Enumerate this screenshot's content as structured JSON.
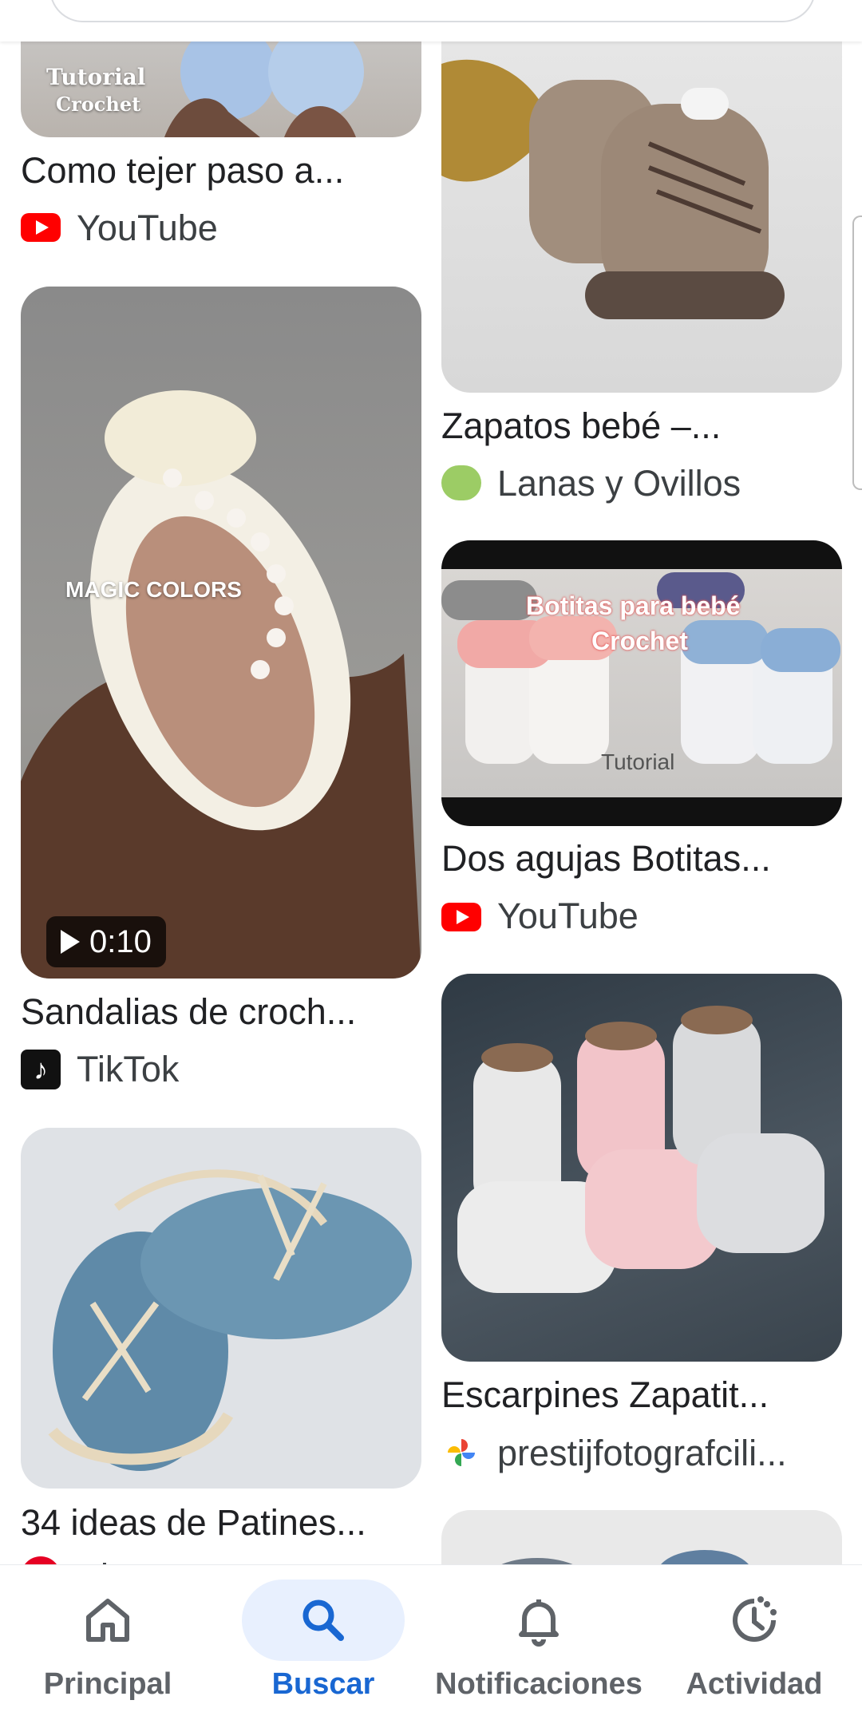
{
  "results_left": [
    {
      "title": "Como tejer paso a...",
      "source": "YouTube",
      "source_icon": "youtube-icon",
      "thumb_text": [
        "Tutorial",
        "Crochet"
      ]
    },
    {
      "title": "Sandalias de croch...",
      "source": "TikTok",
      "source_icon": "tiktok-icon",
      "thumb_text": "MAGIC COLORS",
      "duration": "0:10"
    },
    {
      "title": "34 ideas de Patines...",
      "source": "Pinterest",
      "source_icon": "pinterest-icon"
    }
  ],
  "results_right": [
    {
      "title": "Zapatos bebé –...",
      "source": "Lanas y Ovillos",
      "source_icon": "lanas-y-ovillos-icon"
    },
    {
      "title": "Dos agujas Botitas...",
      "source": "YouTube",
      "source_icon": "youtube-icon",
      "thumb_text": [
        "Botitas para bebé",
        "Crochet",
        "Tutorial"
      ]
    },
    {
      "title": "Escarpines Zapatit...",
      "source": "prestijfotografcili...",
      "source_icon": "google-photos-icon"
    }
  ],
  "nav": {
    "items": [
      {
        "label": "Principal",
        "icon": "home-icon"
      },
      {
        "label": "Buscar",
        "icon": "search-icon",
        "active": true
      },
      {
        "label": "Notificaciones",
        "icon": "bell-icon"
      },
      {
        "label": "Actividad",
        "icon": "activity-icon"
      }
    ]
  },
  "colors": {
    "accent": "#1967d2",
    "active_pill": "#e8f0fe",
    "youtube": "#ff0000"
  }
}
